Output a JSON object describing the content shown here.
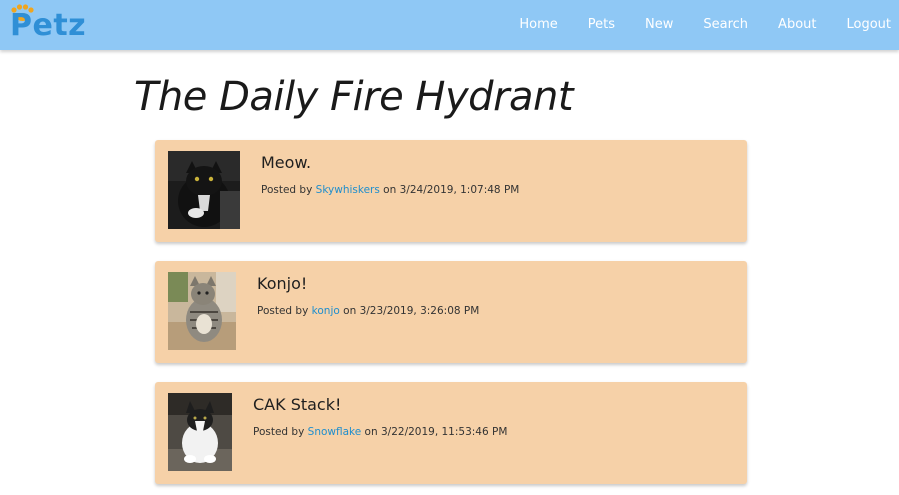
{
  "brand": {
    "name": "Petz",
    "paw_color": "#f0a51e",
    "text_color": "#2f8fd6"
  },
  "nav": {
    "items": [
      {
        "label": "Home"
      },
      {
        "label": "Pets"
      },
      {
        "label": "New"
      },
      {
        "label": "Search"
      },
      {
        "label": "About"
      },
      {
        "label": "Logout"
      }
    ]
  },
  "page": {
    "title": "The Daily Fire Hydrant"
  },
  "colors": {
    "navbar": "#8fc8f5",
    "card": "#f6d1a8",
    "link": "#1f8ecd"
  },
  "posts": [
    {
      "title": "Meow.",
      "posted_by_prefix": "Posted by",
      "author": "Skywhiskers",
      "on_text": "on",
      "timestamp": "3/24/2019, 1:07:48 PM",
      "thumb_icon": "black-cat-photo"
    },
    {
      "title": "Konjo!",
      "posted_by_prefix": "Posted by",
      "author": "konjo",
      "on_text": "on",
      "timestamp": "3/23/2019, 3:26:08 PM",
      "thumb_icon": "tabby-cat-photo"
    },
    {
      "title": "CAK Stack!",
      "posted_by_prefix": "Posted by",
      "author": "Snowflake",
      "on_text": "on",
      "timestamp": "3/22/2019, 11:53:46 PM",
      "thumb_icon": "white-black-cat-photo"
    }
  ]
}
